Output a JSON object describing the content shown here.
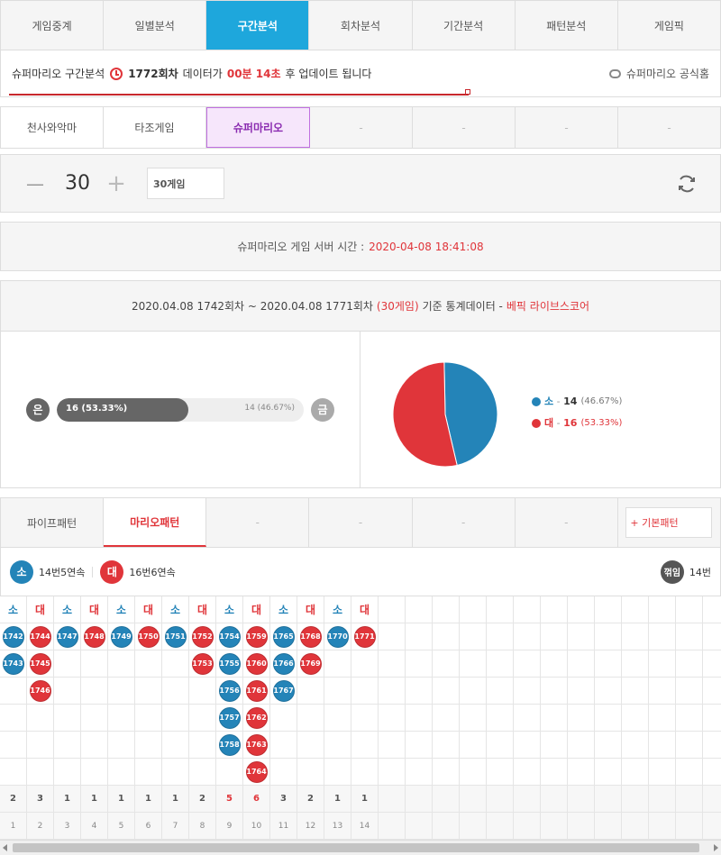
{
  "nav": {
    "tabs": [
      "게임중계",
      "일별분석",
      "구간분석",
      "회차분석",
      "기간분석",
      "패턴분석",
      "게임픽"
    ],
    "active": 2
  },
  "info": {
    "prefix": "슈퍼마리오 구간분석",
    "round": "1772회차",
    "mid": "데이터가",
    "countdown": "00분 14초",
    "suffix": "후 업데이트 됩니다",
    "official_link": "슈퍼마리오 공식홈"
  },
  "games": {
    "tabs": [
      "천사와악마",
      "타조게임",
      "슈퍼마리오",
      "-",
      "-",
      "-",
      "-"
    ],
    "active": 2
  },
  "count": {
    "minus": "—",
    "value": "30",
    "plus": "+",
    "select_value": "30게임"
  },
  "server": {
    "label": "슈퍼마리오 게임 서버 시간 :",
    "time": "2020-04-08 18:41:08"
  },
  "stats": {
    "header_main": "2020.04.08 1742회차 ~ 2020.04.08 1771회차",
    "header_games": "(30게임)",
    "header_mid": "기준 통계데이터 -",
    "header_brand": "베픽 라이브스코어",
    "left_badge": "은",
    "right_badge": "금",
    "bar_left_text": "16 (53.33%)",
    "bar_right_text": "14 (46.67%)",
    "bar_fill_fraction": 0.5333
  },
  "chart_data": {
    "type": "pie",
    "slices": [
      {
        "label": "소",
        "value": 14,
        "percent": "46.67%",
        "color": "#2484b8"
      },
      {
        "label": "대",
        "value": 16,
        "percent": "53.33%",
        "color": "#e0353a"
      }
    ]
  },
  "legend": {
    "items": [
      {
        "label": "소",
        "sep": " - ",
        "count": "14",
        "pct": "(46.67%)",
        "color": "#2484b8"
      },
      {
        "label": "대",
        "sep": " - ",
        "count": "16",
        "pct": "(53.33%)",
        "color": "#e0353a"
      }
    ]
  },
  "patterns": {
    "tabs": [
      "파이프패턴",
      "마리오패턴",
      "-",
      "-",
      "-",
      "-"
    ],
    "active": 1,
    "basic_btn": "+ 기본패턴"
  },
  "pattern_legend": {
    "small_label": "소",
    "small_text": "14번5연속",
    "big_label": "대",
    "big_text": "16번6연속",
    "flip_label": "꺾임",
    "flip_text": "14번"
  },
  "grid": {
    "columns": [
      {
        "head": "소",
        "type": "s",
        "balls": [
          "1742",
          "1743"
        ],
        "count": "2",
        "idx": "1"
      },
      {
        "head": "대",
        "type": "b",
        "balls": [
          "1744",
          "1745",
          "1746"
        ],
        "count": "3",
        "idx": "2"
      },
      {
        "head": "소",
        "type": "s",
        "balls": [
          "1747"
        ],
        "count": "1",
        "idx": "3"
      },
      {
        "head": "대",
        "type": "b",
        "balls": [
          "1748"
        ],
        "count": "1",
        "idx": "4"
      },
      {
        "head": "소",
        "type": "s",
        "balls": [
          "1749"
        ],
        "count": "1",
        "idx": "5"
      },
      {
        "head": "대",
        "type": "b",
        "balls": [
          "1750"
        ],
        "count": "1",
        "idx": "6"
      },
      {
        "head": "소",
        "type": "s",
        "balls": [
          "1751"
        ],
        "count": "1",
        "idx": "7"
      },
      {
        "head": "대",
        "type": "b",
        "balls": [
          "1752",
          "1753"
        ],
        "count": "2",
        "idx": "8"
      },
      {
        "head": "소",
        "type": "s",
        "balls": [
          "1754",
          "1755",
          "1756",
          "1757",
          "1758"
        ],
        "count": "5",
        "idx": "9",
        "hl": true
      },
      {
        "head": "대",
        "type": "b",
        "balls": [
          "1759",
          "1760",
          "1761",
          "1762",
          "1763",
          "1764"
        ],
        "count": "6",
        "idx": "10",
        "hl": true
      },
      {
        "head": "소",
        "type": "s",
        "balls": [
          "1765",
          "1766",
          "1767"
        ],
        "count": "3",
        "idx": "11"
      },
      {
        "head": "대",
        "type": "b",
        "balls": [
          "1768",
          "1769"
        ],
        "count": "2",
        "idx": "12"
      },
      {
        "head": "소",
        "type": "s",
        "balls": [
          "1770"
        ],
        "count": "1",
        "idx": "13"
      },
      {
        "head": "대",
        "type": "b",
        "balls": [
          "1771"
        ],
        "count": "1",
        "idx": "14"
      }
    ],
    "colors": {
      "s": "#2484b8",
      "b": "#e0353a"
    }
  }
}
